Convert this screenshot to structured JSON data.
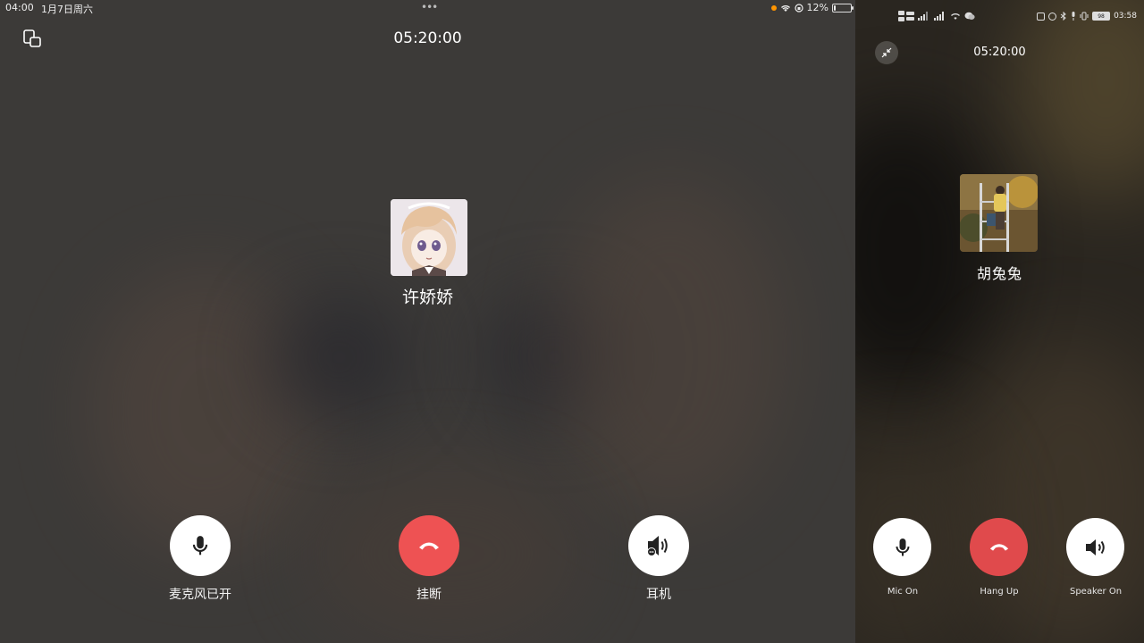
{
  "left": {
    "status": {
      "time": "04:00",
      "date": "1月7日周六",
      "battery": "12%",
      "battery_level": 0.12,
      "dots": "•••"
    },
    "timer": "05:20:00",
    "contact_name": "许娇娇",
    "controls": {
      "mic_label": "麦克风已开",
      "hangup_label": "挂断",
      "audio_label": "耳机"
    }
  },
  "right": {
    "status": {
      "time": "03:58",
      "left_icons": "4G 5G",
      "battery": "98"
    },
    "timer": "05:20:00",
    "contact_name": "胡兔兔",
    "controls": {
      "mic_label": "Mic On",
      "hangup_label": "Hang Up",
      "speaker_label": "Speaker On"
    }
  },
  "colors": {
    "hangup_red": "#ee5253",
    "control_white": "#ffffff",
    "background_dark": "#3c3a38"
  }
}
